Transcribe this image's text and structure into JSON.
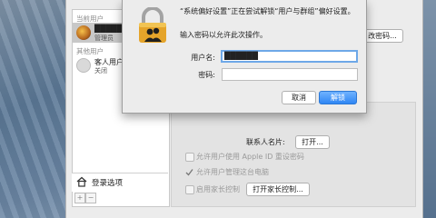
{
  "users_panel": {
    "current_users_header": "当前用户",
    "current_user": {
      "name": "██████",
      "role": "管理员"
    },
    "other_users_header": "其他用户",
    "guest_user": {
      "name": "客人用户",
      "status": "关闭"
    },
    "login_options_label": "登录选项",
    "add_label": "+",
    "remove_label": "−"
  },
  "dialog": {
    "message": "“系统偏好设置”正在尝试解锁“用户与群组”偏好设置。",
    "sub_message": "输入密码以允许此次操作。",
    "username_label": "用户名:",
    "username_value": "██████",
    "password_label": "密码:",
    "password_value": "",
    "cancel_label": "取消",
    "unlock_label": "解锁"
  },
  "detail": {
    "change_password_partial": "改密码...",
    "contacts_card_label": "联系人名片:",
    "open_button": "打开...",
    "allow_apple_id_reset": "允许用户使用 Apple ID 重设密码",
    "allow_admin": "允许用户管理这台电脑",
    "allow_admin_checked": true,
    "parental_controls_label": "启用家长控制",
    "open_parental_controls_button": "打开家长控制..."
  },
  "colors": {
    "accent": "#2f86f4",
    "lock_body": "#e5a42a"
  }
}
